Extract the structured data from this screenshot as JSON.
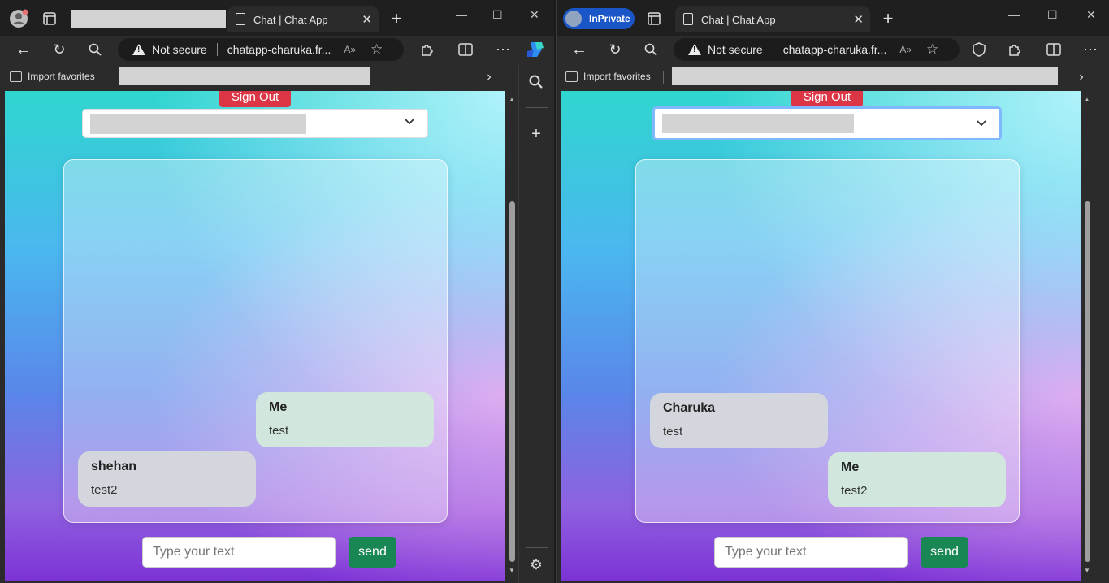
{
  "browser_left": {
    "tab_title": "Chat | Chat App",
    "address_warning": "Not secure",
    "address_url": "chatapp-charuka.fr...",
    "favorites_import": "Import favorites"
  },
  "browser_right": {
    "private_label": "InPrivate",
    "tab_title": "Chat | Chat App",
    "address_warning": "Not secure",
    "address_url": "chatapp-charuka.fr...",
    "favorites_import": "Import favorites"
  },
  "chat_left": {
    "sign_out": "Sign Out",
    "messages": [
      {
        "sender": "Me",
        "text": "test",
        "mine": true
      },
      {
        "sender": "shehan",
        "text": "test2",
        "mine": false
      }
    ],
    "input_placeholder": "Type your text",
    "send_label": "send"
  },
  "chat_right": {
    "sign_out": "Sign Out",
    "messages": [
      {
        "sender": "Charuka",
        "text": "test",
        "mine": false
      },
      {
        "sender": "Me",
        "text": "test2",
        "mine": true
      }
    ],
    "input_placeholder": "Type your text",
    "send_label": "send"
  },
  "colors": {
    "sign_out": "#dc3545",
    "send": "#198754",
    "bubble_me": "#d1e7dd",
    "bubble_other": "#d3d6dc",
    "inprivate": "#1a56c8"
  }
}
